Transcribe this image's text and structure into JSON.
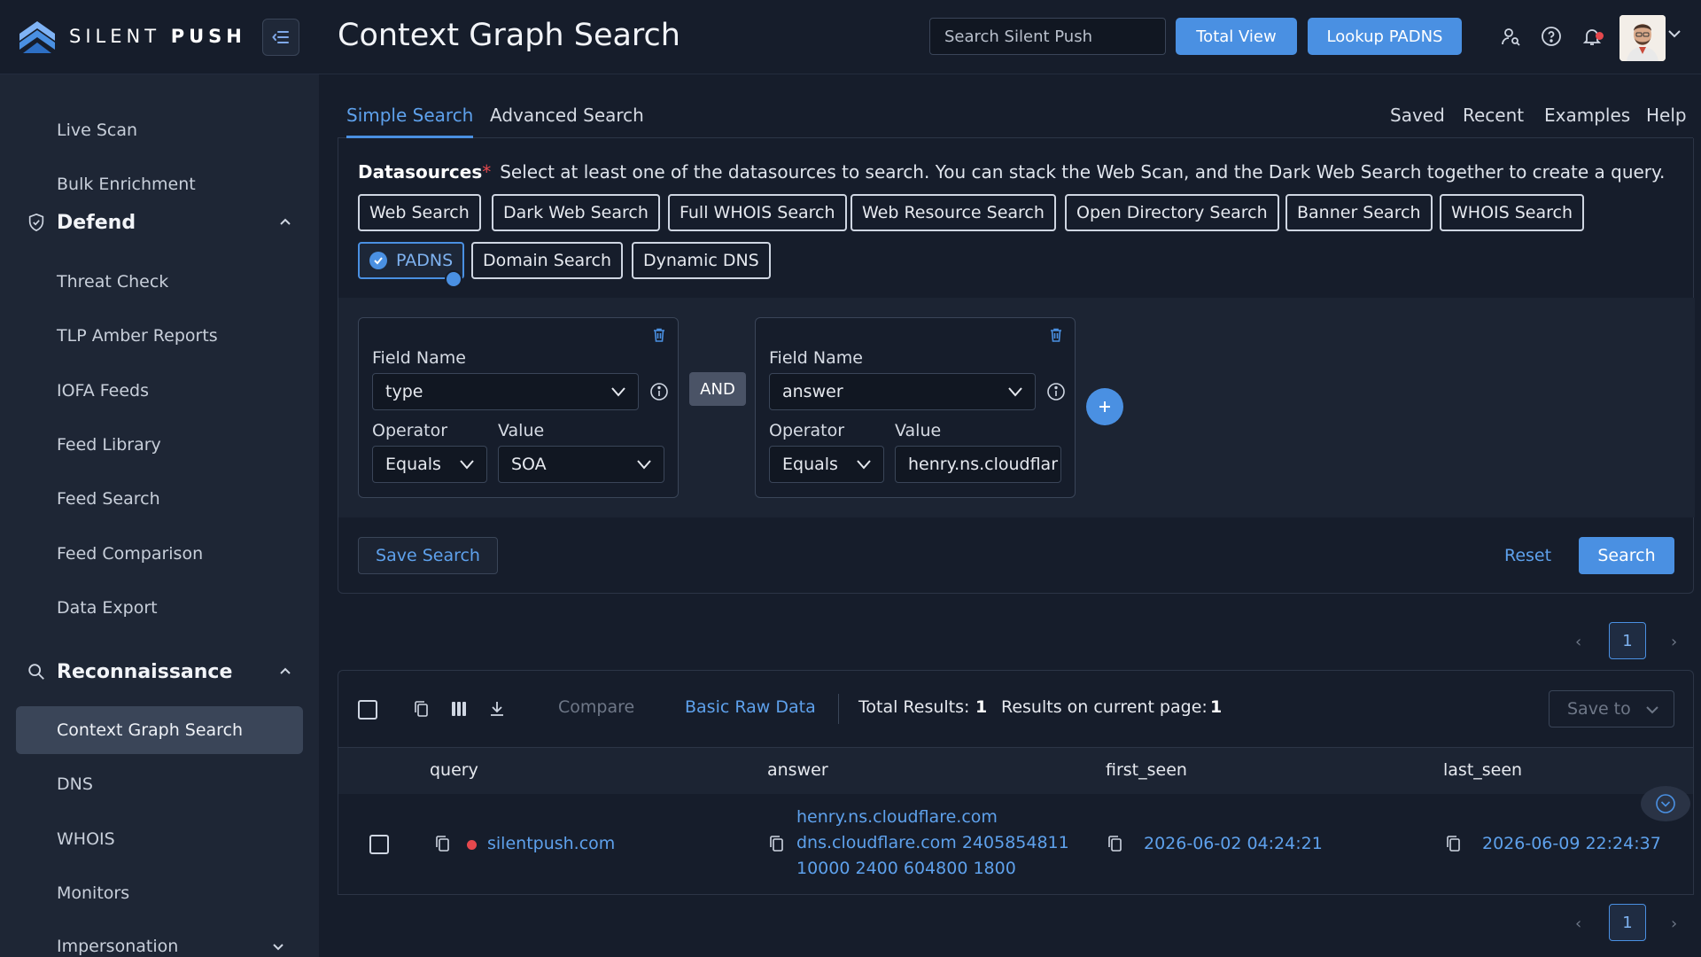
{
  "app": {
    "brand_light": "SILENT",
    "brand_bold": "PUSH",
    "page_title": "Context Graph Search"
  },
  "header": {
    "search_placeholder": "Search Silent Push",
    "total_view_label": "Total View",
    "lookup_label": "Lookup PADNS"
  },
  "sidebar": {
    "items_top": [
      "Live Scan",
      "Bulk Enrichment"
    ],
    "defend": {
      "title": "Defend",
      "items": [
        "Threat Check",
        "TLP Amber Reports",
        "IOFA Feeds",
        "Feed Library",
        "Feed Search",
        "Feed Comparison",
        "Data Export"
      ]
    },
    "recon": {
      "title": "Reconnaissance",
      "items": [
        "Context Graph Search",
        "DNS",
        "WHOIS",
        "Monitors",
        "Impersonation"
      ]
    }
  },
  "tabs": {
    "simple": "Simple Search",
    "advanced": "Advanced Search",
    "saved": "Saved",
    "recent": "Recent",
    "examples": "Examples",
    "help": "Help"
  },
  "datasources": {
    "label": "Datasources",
    "required_mark": "*",
    "hint": "Select at least one of the datasources to search. You can stack the Web Scan, and the Dark Web Search together to create a query.",
    "chips": [
      "Web Search",
      "Dark Web Search",
      "Full WHOIS Search",
      "Web Resource Search",
      "Open Directory Search",
      "Banner Search",
      "WHOIS Search",
      "PADNS",
      "Domain Search",
      "Dynamic DNS"
    ],
    "selected": "PADNS"
  },
  "conditions": [
    {
      "field_label": "Field Name",
      "field": "type",
      "operator_label": "Operator",
      "operator": "Equals",
      "value_label": "Value",
      "value": "SOA"
    },
    {
      "field_label": "Field Name",
      "field": "answer",
      "operator_label": "Operator",
      "operator": "Equals",
      "value_label": "Value",
      "value": "henry.ns.cloudflar"
    }
  ],
  "joiner": "AND",
  "actions": {
    "save_search": "Save Search",
    "reset": "Reset",
    "search": "Search"
  },
  "pagination": {
    "current_page": "1"
  },
  "results": {
    "compare": "Compare",
    "basic_raw": "Basic Raw Data",
    "total_label": "Total Results:",
    "total_value": "1",
    "page_label": "Results on current page:",
    "page_value": "1",
    "save_to": "Save to",
    "columns": [
      "query",
      "answer",
      "first_seen",
      "last_seen"
    ],
    "rows": [
      {
        "query": "silentpush.com",
        "answer_lines": [
          "henry.ns.cloudflare.com",
          "dns.cloudflare.com 2405854811",
          "10000 2400 604800 1800"
        ],
        "first_seen": "2026-06-02 04:24:21",
        "last_seen": "2026-06-09 22:24:37"
      }
    ]
  },
  "colors": {
    "accent": "#4a90e2",
    "background": "#161d2b",
    "sidebar": "#1e2635",
    "danger": "#e5484d"
  }
}
